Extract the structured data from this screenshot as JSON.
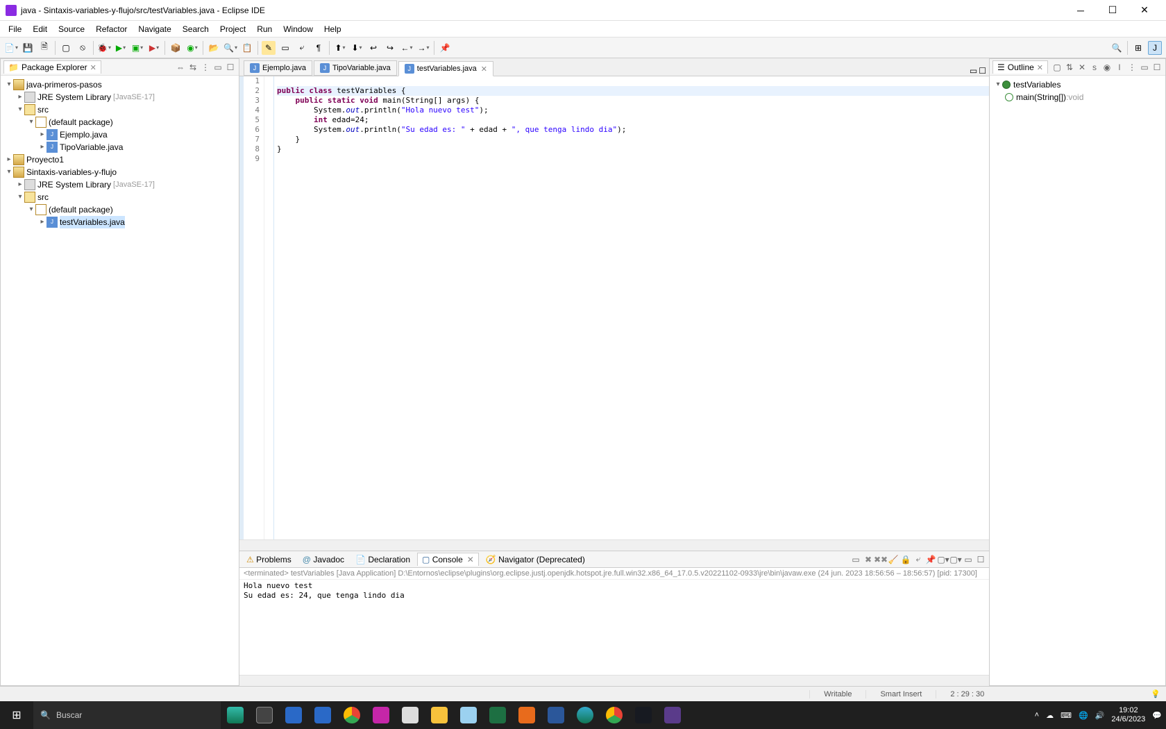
{
  "window": {
    "title": "java - Sintaxis-variables-y-flujo/src/testVariables.java - Eclipse IDE"
  },
  "menu": [
    "File",
    "Edit",
    "Source",
    "Refactor",
    "Navigate",
    "Search",
    "Project",
    "Run",
    "Window",
    "Help"
  ],
  "package_explorer": {
    "title": "Package Explorer",
    "projects": [
      {
        "name": "java-primeros-pasos",
        "expanded": true,
        "children": [
          {
            "type": "lib",
            "name": "JRE System Library",
            "suffix": "[JavaSE-17]"
          },
          {
            "type": "src",
            "name": "src",
            "expanded": true,
            "children": [
              {
                "type": "pkg",
                "name": "(default package)",
                "expanded": true,
                "children": [
                  {
                    "type": "java",
                    "name": "Ejemplo.java"
                  },
                  {
                    "type": "java",
                    "name": "TipoVariable.java"
                  }
                ]
              }
            ]
          }
        ]
      },
      {
        "name": "Proyecto1",
        "expanded": false
      },
      {
        "name": "Sintaxis-variables-y-flujo",
        "expanded": true,
        "children": [
          {
            "type": "lib",
            "name": "JRE System Library",
            "suffix": "[JavaSE-17]"
          },
          {
            "type": "src",
            "name": "src",
            "expanded": true,
            "children": [
              {
                "type": "pkg",
                "name": "(default package)",
                "expanded": true,
                "children": [
                  {
                    "type": "java",
                    "name": "testVariables.java",
                    "selected": true
                  }
                ]
              }
            ]
          }
        ]
      }
    ]
  },
  "editor": {
    "tabs": [
      {
        "name": "Ejemplo.java",
        "active": false
      },
      {
        "name": "TipoVariable.java",
        "active": false
      },
      {
        "name": "testVariables.java",
        "active": true
      }
    ],
    "line_numbers": [
      "1",
      "2",
      "3",
      "4",
      "5",
      "6",
      "7",
      "8",
      "9"
    ],
    "code_html": "\n<span class=\"hl-line\"><span class=\"kw\">public</span> <span class=\"kw\">class</span> testVariables {</span>    <span class=\"kw\">public</span> <span class=\"kw\">static</span> <span class=\"kw\">void</span> main(String[] args) {\n        System.<span class=\"fld\">out</span>.println(<span class=\"str\">\"Hola nuevo test\"</span>);\n        <span class=\"kw\">int</span> edad=24;\n        System.<span class=\"fld\">out</span>.println(<span class=\"str\">\"Su edad es: \"</span> + edad + <span class=\"str\">\", que tenga lindo dia\"</span>);\n    }\n}\n"
  },
  "outline": {
    "title": "Outline",
    "items": [
      {
        "type": "class",
        "name": "testVariables",
        "children": [
          {
            "type": "method",
            "name": "main(String[])",
            "ret": "void"
          }
        ]
      }
    ]
  },
  "console_panel": {
    "tabs": [
      {
        "label": "Problems",
        "icon": "⚠"
      },
      {
        "label": "Javadoc",
        "icon": "@"
      },
      {
        "label": "Declaration",
        "icon": "📄"
      },
      {
        "label": "Console",
        "icon": "▢",
        "active": true
      },
      {
        "label": "Navigator (Deprecated)",
        "icon": "🧭"
      }
    ],
    "launch_info": "<terminated> testVariables [Java Application] D:\\Entornos\\eclipse\\plugins\\org.eclipse.justj.openjdk.hotspot.jre.full.win32.x86_64_17.0.5.v20221102-0933\\jre\\bin\\javaw.exe  (24 jun. 2023 18:56:56 – 18:56:57) [pid: 17300]",
    "output": "Hola nuevo test\nSu edad es: 24, que tenga lindo dia"
  },
  "status_bar": {
    "writable": "Writable",
    "insert": "Smart Insert",
    "pos": "2 : 29 : 30"
  },
  "taskbar": {
    "search_placeholder": "Buscar",
    "time": "19:02",
    "date": "24/6/2023"
  }
}
